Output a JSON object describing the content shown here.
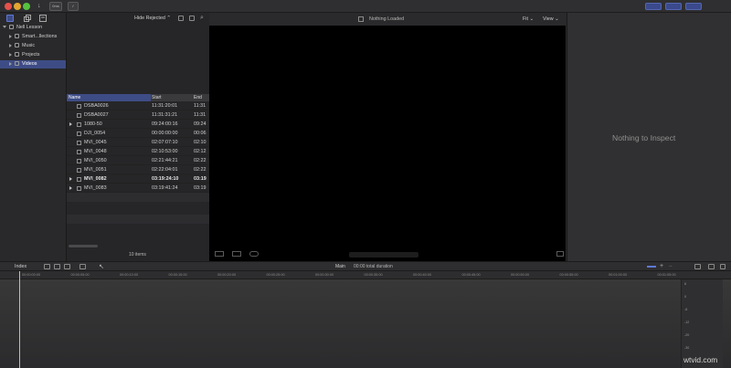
{
  "colors": {
    "accent": "#3e4c86",
    "traffic_close": "#e4514a",
    "traffic_min": "#e3a630",
    "traffic_max": "#56c13f"
  },
  "toolbar": {
    "share_icon": "download-arrow-icon",
    "key_button": "0ms",
    "record_icon": "checkmark-icon"
  },
  "libraries": [
    {
      "label": "Nell Lesson",
      "indent": 0,
      "open": true,
      "selected": false
    },
    {
      "label": "Smart...llections",
      "indent": 1,
      "open": false,
      "selected": false
    },
    {
      "label": "Music",
      "indent": 1,
      "open": false,
      "selected": false
    },
    {
      "label": "Projects",
      "indent": 1,
      "open": false,
      "selected": false
    },
    {
      "label": "Videos",
      "indent": 1,
      "open": false,
      "selected": true
    }
  ],
  "browser": {
    "filter": "Hide Rejected ⌃",
    "columns": {
      "name": "Name",
      "start": "Start",
      "end": "End"
    },
    "clips": [
      {
        "name": "DSBA0026",
        "start": "11:31:20:01",
        "end": "11:31",
        "arrow": false,
        "bold": false
      },
      {
        "name": "DSBA0027",
        "start": "11:31:31:21",
        "end": "11:31",
        "arrow": false,
        "bold": false
      },
      {
        "name": "1080-50",
        "start": "09:24:00:16",
        "end": "09:24",
        "arrow": true,
        "bold": false
      },
      {
        "name": "DJI_0054",
        "start": "00:00:00:00",
        "end": "00:06",
        "arrow": false,
        "bold": false
      },
      {
        "name": "MVI_0045",
        "start": "02:07:07:10",
        "end": "02:10",
        "arrow": false,
        "bold": false
      },
      {
        "name": "MVI_0048",
        "start": "02:10:53:00",
        "end": "02:12",
        "arrow": false,
        "bold": false
      },
      {
        "name": "MVI_0050",
        "start": "02:21:44:21",
        "end": "02:22",
        "arrow": false,
        "bold": false
      },
      {
        "name": "MVI_0051",
        "start": "02:22:04:01",
        "end": "02:22",
        "arrow": false,
        "bold": false
      },
      {
        "name": "MVI_0082",
        "start": "03:19:24:10",
        "end": "03:19",
        "arrow": true,
        "bold": true
      },
      {
        "name": "MVI_0083",
        "start": "03:19:41:24",
        "end": "03:19",
        "arrow": true,
        "bold": false
      }
    ],
    "items_count": "10 items"
  },
  "viewer": {
    "status": "Nothing Loaded",
    "fit": "Fit ⌄",
    "view": "View ⌄"
  },
  "inspector": {
    "empty_text": "Nothing to Inspect"
  },
  "timeline": {
    "index_label": "Index",
    "project": "Main",
    "duration": "00:00 total duration",
    "timecodes": [
      "00:00:00:00",
      "00:00:05:00",
      "00:00:10:00",
      "00:00:15:00",
      "00:00:20:00",
      "00:00:25:00",
      "00:00:30:00",
      "00:00:35:00",
      "00:00:40:00",
      "00:00:45:00",
      "00:00:50:00",
      "00:00:55:00",
      "00:01:00:00",
      "00:01:05:00"
    ],
    "meter_labels": [
      "6",
      "0",
      "-6",
      "-12",
      "-20",
      "-30"
    ]
  },
  "watermark": "wtvid.com"
}
